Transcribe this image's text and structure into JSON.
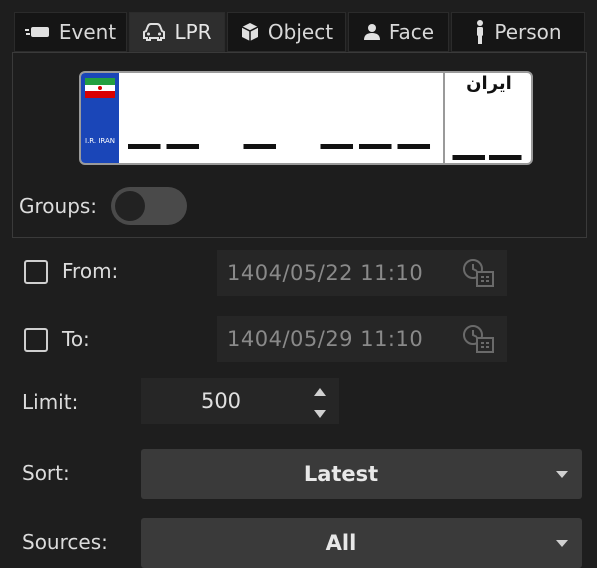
{
  "tabs": [
    {
      "label": "Event",
      "icon": "event-icon",
      "active": false
    },
    {
      "label": "LPR",
      "icon": "car-icon",
      "active": true
    },
    {
      "label": "Object",
      "icon": "cube-icon",
      "active": false
    },
    {
      "label": "Face",
      "icon": "face-icon",
      "active": false
    },
    {
      "label": "Person",
      "icon": "person-icon",
      "active": false
    }
  ],
  "plate": {
    "side_label": "I.R. IRAN",
    "main_text": "__ _ ___",
    "country_text": "ایران",
    "code_text": "__"
  },
  "groups": {
    "label": "Groups:",
    "enabled": false
  },
  "from": {
    "label": "From:",
    "checked": false,
    "value": "1404/05/22  11:10"
  },
  "to": {
    "label": "To:",
    "checked": false,
    "value": "1404/05/29  11:10"
  },
  "limit": {
    "label": "Limit:",
    "value": "500"
  },
  "sort": {
    "label": "Sort:",
    "value": "Latest"
  },
  "sources": {
    "label": "Sources:",
    "value": "All"
  },
  "colors": {
    "background": "#1e1e1e",
    "plate_blue": "#1a46b8",
    "active_tab": "#2e2e2e"
  }
}
